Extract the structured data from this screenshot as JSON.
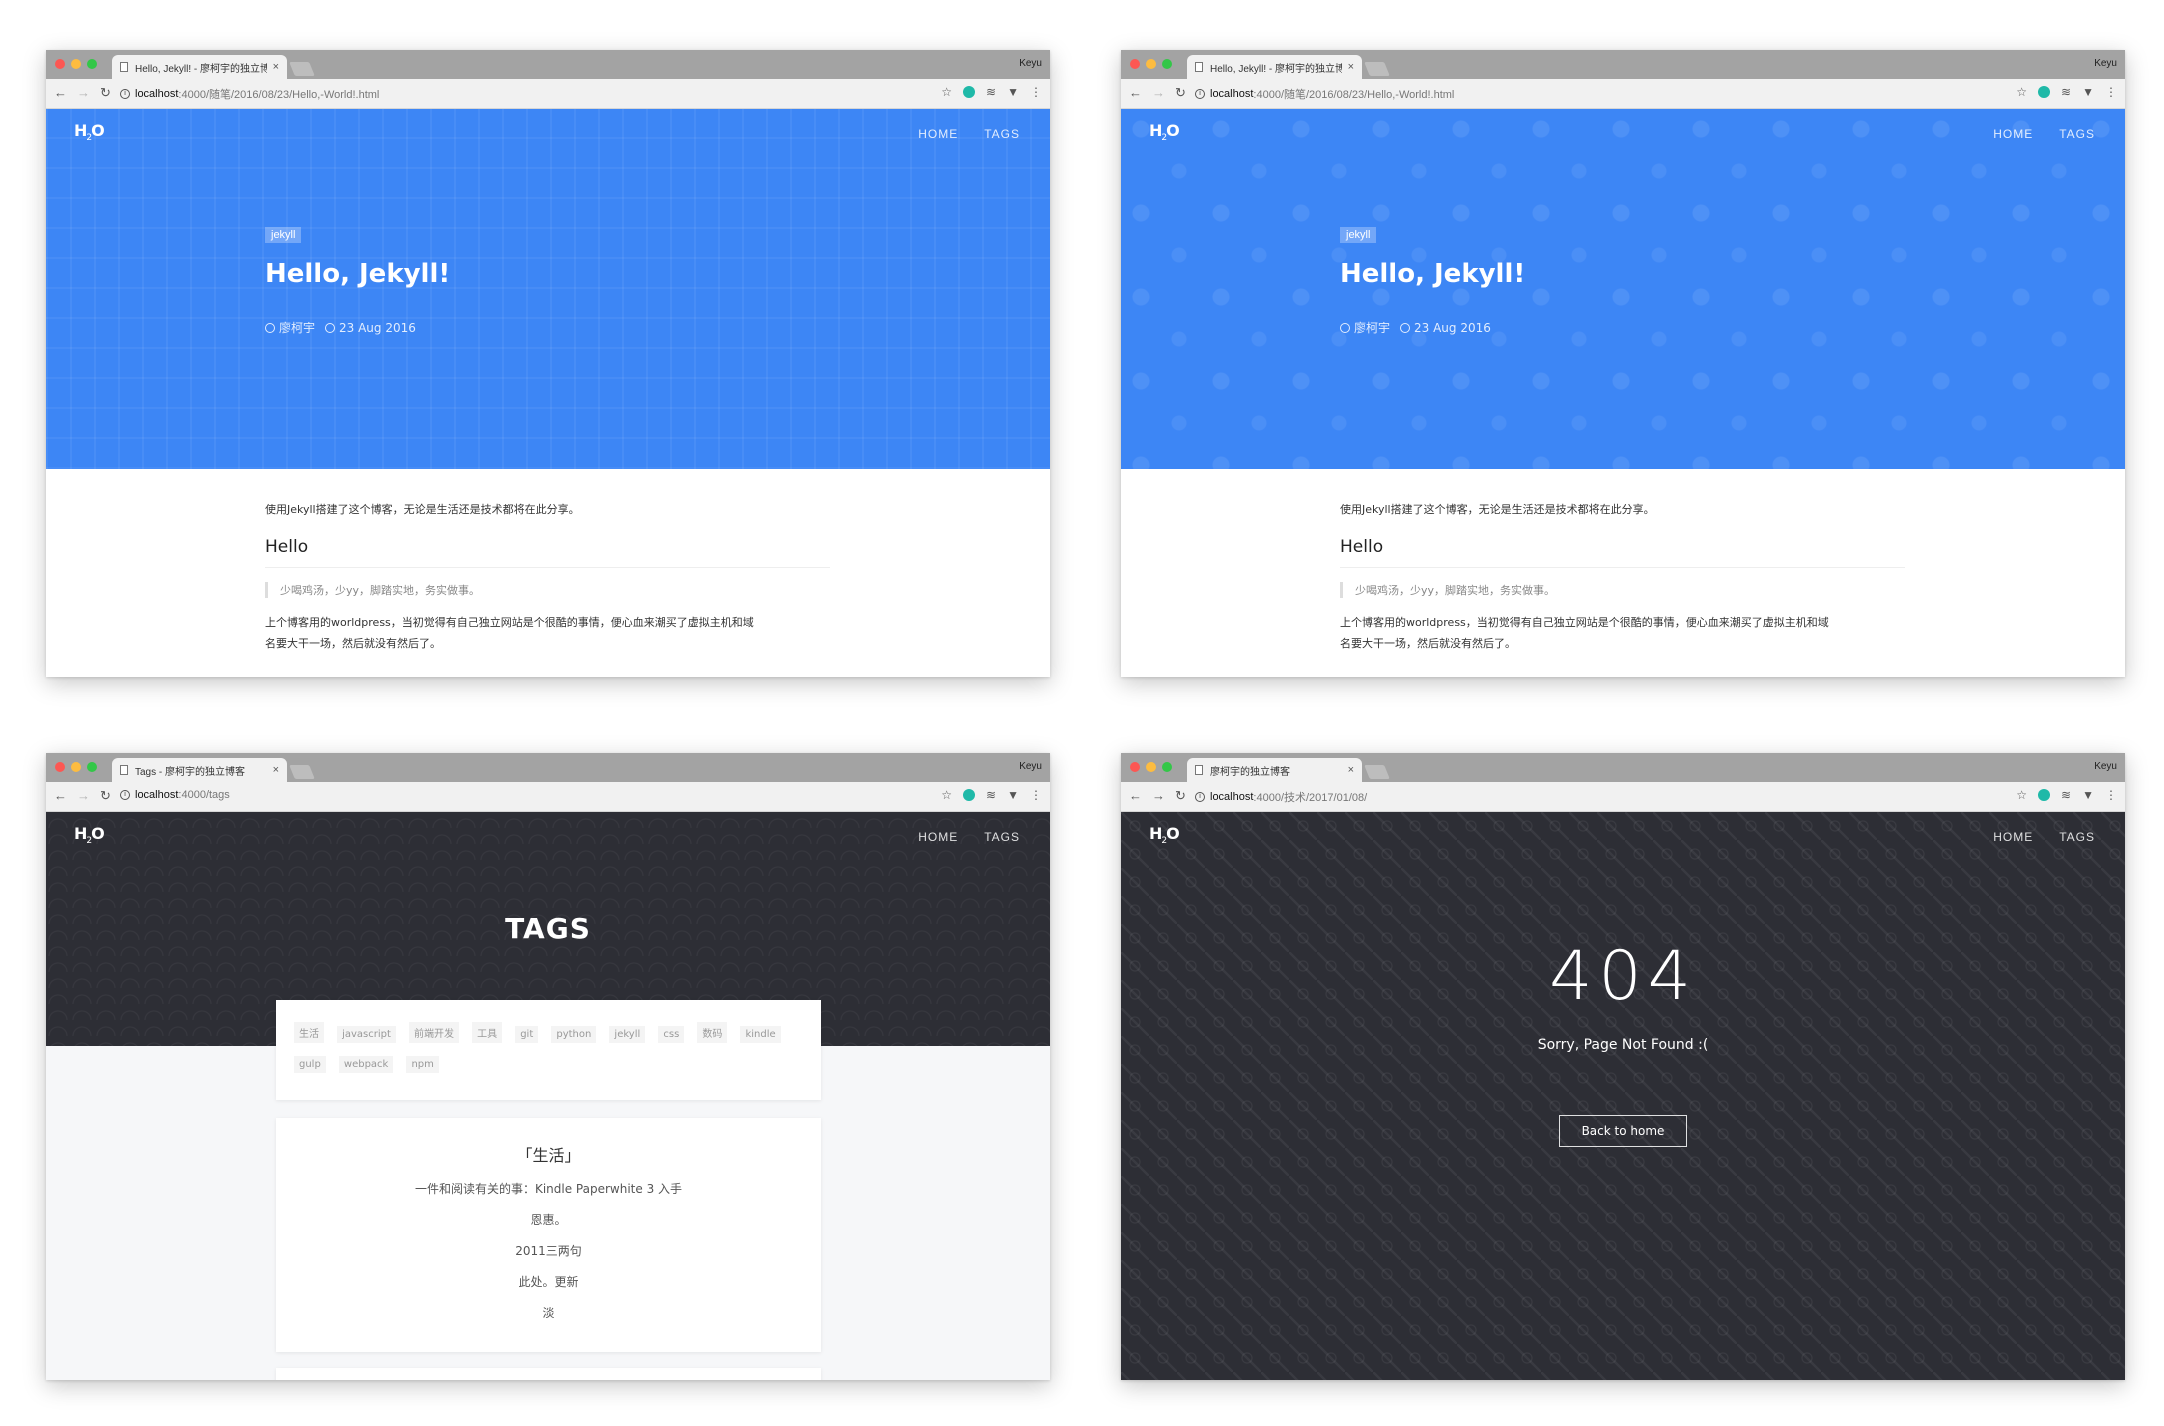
{
  "common": {
    "user": "Keyu",
    "logo_main": "H",
    "logo_sub": "2",
    "logo_tail": "O",
    "menu": [
      "HOME",
      "TAGS"
    ],
    "info_icon": "info-icon"
  },
  "windows": [
    {
      "tab_title": "Hello, Jekyll! - 廖柯宇的独立博客",
      "url_host": "localhost",
      "url_path": ":4000/随笔/2016/08/23/Hello,-World!.html",
      "tag": "jekyll",
      "title": "Hello, Jekyll!",
      "author": "廖柯宇",
      "date": "23 Aug 2016",
      "intro": "使用Jekyll搭建了这个博客，无论是生活还是技术都将在此分享。",
      "heading": "Hello",
      "quote": "少喝鸡汤，少yy，脚踏实地，务实做事。",
      "para_line1": "上个博客用的worldpress，当初觉得有自己独立网站是个很酷的事情，便心血来潮买了虚拟主机和域",
      "para_line2": "名要大干一场，然后就没有然后了。",
      "hero_color": "#3d86f5"
    },
    {
      "tab_title": "Hello, Jekyll! - 廖柯宇的独立博客",
      "url_host": "localhost",
      "url_path": ":4000/随笔/2016/08/23/Hello,-World!.html",
      "tag": "jekyll",
      "title": "Hello, Jekyll!",
      "author": "廖柯宇",
      "date": "23 Aug 2016",
      "intro": "使用Jekyll搭建了这个博客，无论是生活还是技术都将在此分享。",
      "heading": "Hello",
      "quote": "少喝鸡汤，少yy，脚踏实地，务实做事。",
      "para_line1": "上个博客用的worldpress，当初觉得有自己独立网站是个很酷的事情，便心血来潮买了虚拟主机和域",
      "para_line2": "名要大干一场，然后就没有然后了。",
      "hero_color": "#3d86f5"
    },
    {
      "tab_title": "Tags - 廖柯宇的独立博客",
      "url_host": "localhost",
      "url_path": ":4000/tags",
      "title": "TAGS",
      "tags_row1": [
        "生活",
        "javascript",
        "前端开发",
        "工具",
        "git",
        "python",
        "jekyll",
        "css",
        "数码",
        "kindle"
      ],
      "tags_row2": [
        "gulp",
        "webpack",
        "npm"
      ],
      "section_title": "「生活」",
      "items": [
        "一件和阅读有关的事：Kindle Paperwhite 3 入手",
        "恩惠。",
        "2011三两句",
        "此处。更新",
        "淡"
      ],
      "hero_color": "#2d2e35"
    },
    {
      "tab_title": "廖柯宇的独立博客",
      "url_host": "localhost",
      "url_path": ":4000/技术/2017/01/08/",
      "code": "404",
      "message": "Sorry, Page Not Found :(",
      "button": "Back to home",
      "hero_color": "#2d2e35"
    }
  ]
}
